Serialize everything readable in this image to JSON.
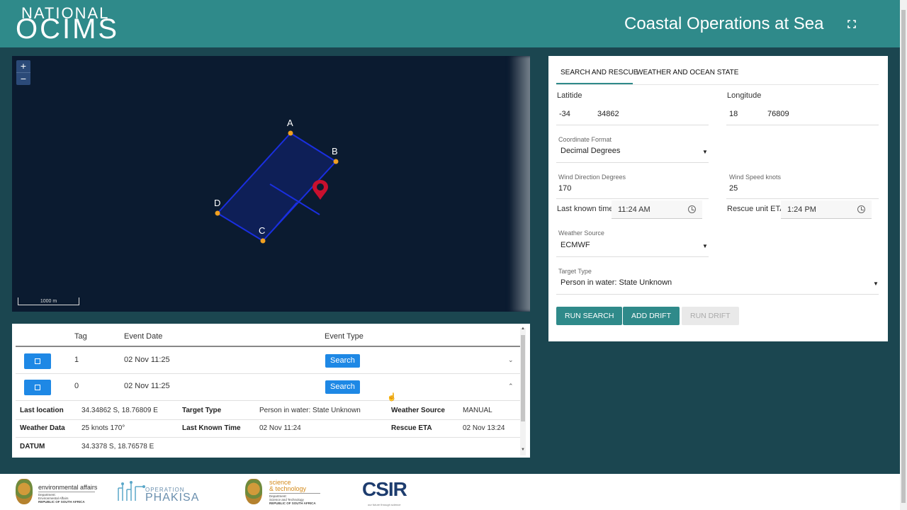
{
  "header": {
    "logo_line1": "NATIONAL",
    "logo_line2": "OCIMS",
    "title": "Coastal Operations at Sea",
    "fullscreen_icon": "fullscreen-icon"
  },
  "map": {
    "zoom_in": "+",
    "zoom_out": "−",
    "scale_label": "1000 m",
    "points": {
      "a": "A",
      "b": "B",
      "c": "C",
      "d": "D"
    },
    "marker_icon": "map-pin-icon",
    "colors": {
      "water": "#0b1b30",
      "box": "#1a2fe0",
      "point": "#f0a020",
      "marker": "#c8102e"
    }
  },
  "events": {
    "headers": {
      "tag": "Tag",
      "date": "Event Date",
      "type": "Event Type"
    },
    "rows": [
      {
        "tag": "1",
        "date": "02 Nov 11:25",
        "type": "Search",
        "expanded": false
      },
      {
        "tag": "0",
        "date": "02 Nov 11:25",
        "type": "Search",
        "expanded": true
      }
    ],
    "details": {
      "last_location_label": "Last location",
      "last_location": "34.34862 S, 18.76809 E",
      "target_type_label": "Target Type",
      "target_type": "Person in water: State Unknown",
      "weather_source_label": "Weather Source",
      "weather_source": "MANUAL",
      "weather_data_label": "Weather Data",
      "weather_data": "25 knots 170°",
      "last_known_time_label": "Last Known Time",
      "last_known_time": "02 Nov 11:24",
      "rescue_eta_label": "Rescue ETA",
      "rescue_eta": "02 Nov 13:24",
      "datum_label": "DATUM",
      "datum": "34.3378 S, 18.76578 E"
    }
  },
  "form": {
    "tabs": [
      "SEARCH AND RESCUE",
      "WEATHER AND OCEAN STATE"
    ],
    "latitude_label": "Latitide",
    "latitude_deg": "-34",
    "latitude_dec": "34862",
    "longitude_label": "Longitude",
    "longitude_deg": "18",
    "longitude_dec": "76809",
    "coord_format_label": "Coordinate Format",
    "coord_format": "Decimal Degrees",
    "wind_dir_label": "Wind Direction Degrees",
    "wind_dir": "170",
    "wind_speed_label": "Wind Speed knots",
    "wind_speed": "25",
    "last_known_time_label": "Last known time",
    "last_known_time": "11:24 AM",
    "rescue_eta_label": "Rescue unit ETA",
    "rescue_eta": "1:24 PM",
    "weather_source_label": "Weather Source",
    "weather_source": "ECMWF",
    "target_type_label": "Target Type",
    "target_type": "Person in water: State Unknown",
    "buttons": {
      "run_search": "RUN SEARCH",
      "add_drift": "ADD DRIFT",
      "run_drift": "RUN DRIFT"
    },
    "accent": "#2f8a8a"
  },
  "footer": {
    "env_title": "environmental affairs",
    "env_sub1": "Department:",
    "env_sub2": "Environmental Affairs",
    "env_sub3": "REPUBLIC OF SOUTH AFRICA",
    "phakisa_top": "OPERATION",
    "phakisa_main": "PHAKISA",
    "sci_title1": "science",
    "sci_title2": "& technology",
    "sci_sub1": "Department:",
    "sci_sub2": "Science and Technology",
    "sci_sub3": "REPUBLIC OF SOUTH AFRICA",
    "csir": "CSIR",
    "csir_tag": "our future through science"
  }
}
